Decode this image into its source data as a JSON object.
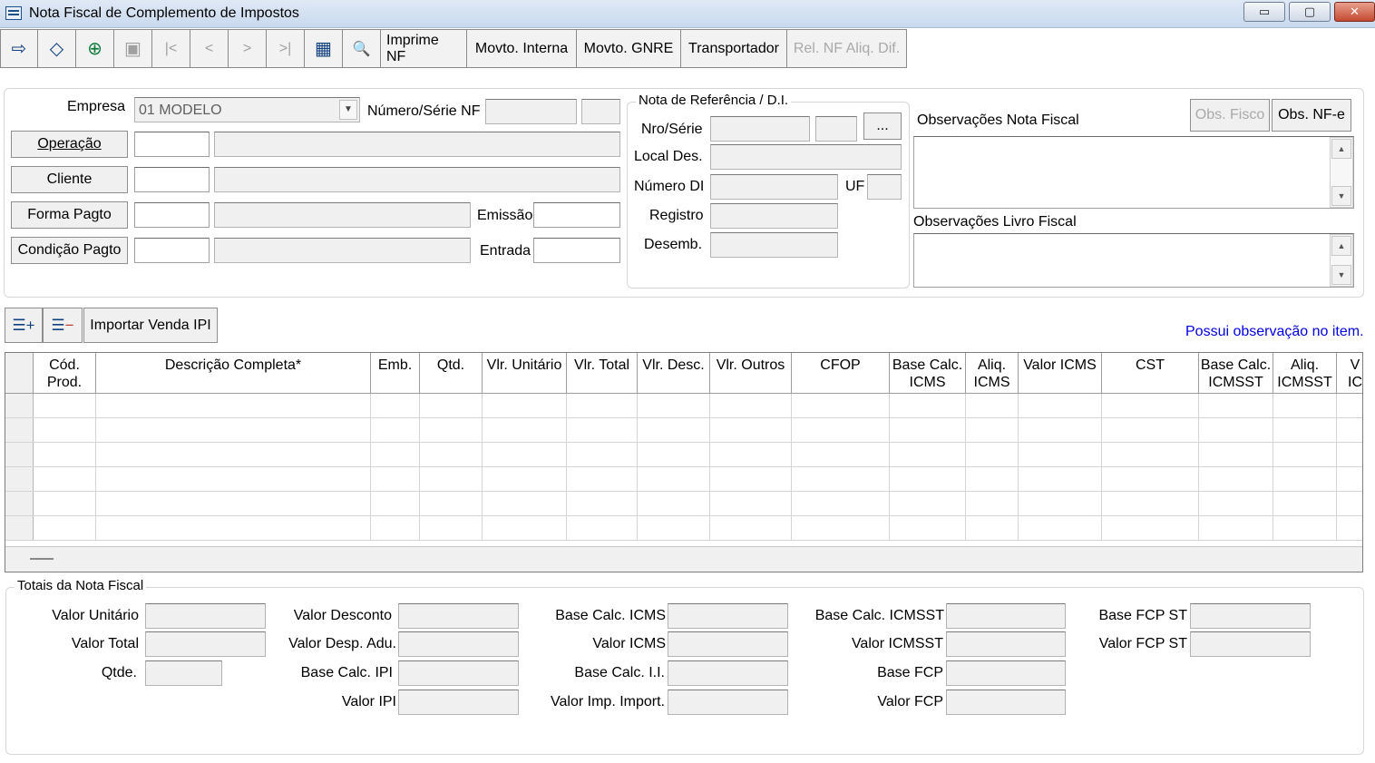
{
  "window": {
    "title": "Nota Fiscal de Complemento de Impostos",
    "buttons": [
      "▭",
      "▢",
      "✕"
    ]
  },
  "toolbar": {
    "icons": [
      {
        "name": "exit-icon",
        "glyph": "⇨"
      },
      {
        "name": "eraser-icon",
        "glyph": "◇"
      },
      {
        "name": "add-icon",
        "glyph": "⊕"
      },
      {
        "name": "save-icon",
        "glyph": "▣"
      },
      {
        "name": "first-icon",
        "glyph": "|<"
      },
      {
        "name": "prev-icon",
        "glyph": "<"
      },
      {
        "name": "next-icon",
        "glyph": ">"
      },
      {
        "name": "last-icon",
        "glyph": ">|"
      },
      {
        "name": "table-icon",
        "glyph": "▦"
      },
      {
        "name": "search-icon",
        "glyph": "🔍"
      }
    ],
    "imprime_nf": "Imprime NF",
    "movto_interna": "Movto. Interna",
    "movto_gnre": "Movto. GNRE",
    "transportador": "Transportador",
    "rel_nf": "Rel. NF Aliq. Dif."
  },
  "form": {
    "empresa_label": "Empresa",
    "empresa_value": "01 MODELO",
    "numero_serie_label": "Número/Série NF",
    "operacao_btn": "Operação",
    "cliente_btn": "Cliente",
    "forma_pagto_btn": "Forma Pagto",
    "condicao_pagto_btn": "Condição Pagto",
    "emissao_label": "Emissão",
    "entrada_label": "Entrada"
  },
  "referencia": {
    "title": "Nota de Referência / D.I.",
    "nro_serie": "Nro/Série",
    "ellipsis": "...",
    "local_des": "Local Des.",
    "numero_di": "Número DI",
    "uf": "UF",
    "registro": "Registro",
    "desemb": "Desemb."
  },
  "observacoes": {
    "nota_fiscal_label": "Observações Nota Fiscal",
    "obs_fisco": "Obs. Fisco",
    "obs_nfe": "Obs. NF-e",
    "livro_fiscal_label": "Observações Livro Fiscal"
  },
  "items": {
    "importar_btn": "Importar Venda IPI",
    "note": "Possui observação no item.",
    "columns": [
      "",
      "Cód.\nProd.",
      "Descrição Completa*",
      "Emb.",
      "Qtd.",
      "Vlr. Unitário",
      "Vlr. Total",
      "Vlr. Desc.",
      "Vlr. Outros",
      "CFOP",
      "Base Calc.\nICMS",
      "Aliq.\nICMS",
      "Valor ICMS",
      "CST",
      "Base Calc.\nICMSST",
      "Aliq.\nICMSST",
      "V\nIC"
    ]
  },
  "totais": {
    "title": "Totais da Nota Fiscal",
    "valor_unitario": "Valor Unitário",
    "valor_total": "Valor Total",
    "qtde": "Qtde.",
    "valor_desconto": "Valor Desconto",
    "valor_desp_adu": "Valor Desp. Adu.",
    "base_calc_ipi": "Base Calc. IPI",
    "valor_ipi": "Valor IPI",
    "base_calc_icms": "Base Calc. ICMS",
    "valor_icms": "Valor ICMS",
    "base_calc_ii": "Base Calc. I.I.",
    "valor_imp_import": "Valor Imp. Import.",
    "base_calc_icmsst": "Base Calc. ICMSST",
    "valor_icmsst": "Valor ICMSST",
    "base_fcp": "Base FCP",
    "valor_fcp": "Valor FCP",
    "base_fcp_st": "Base FCP ST",
    "valor_fcp_st": "Valor FCP ST"
  }
}
